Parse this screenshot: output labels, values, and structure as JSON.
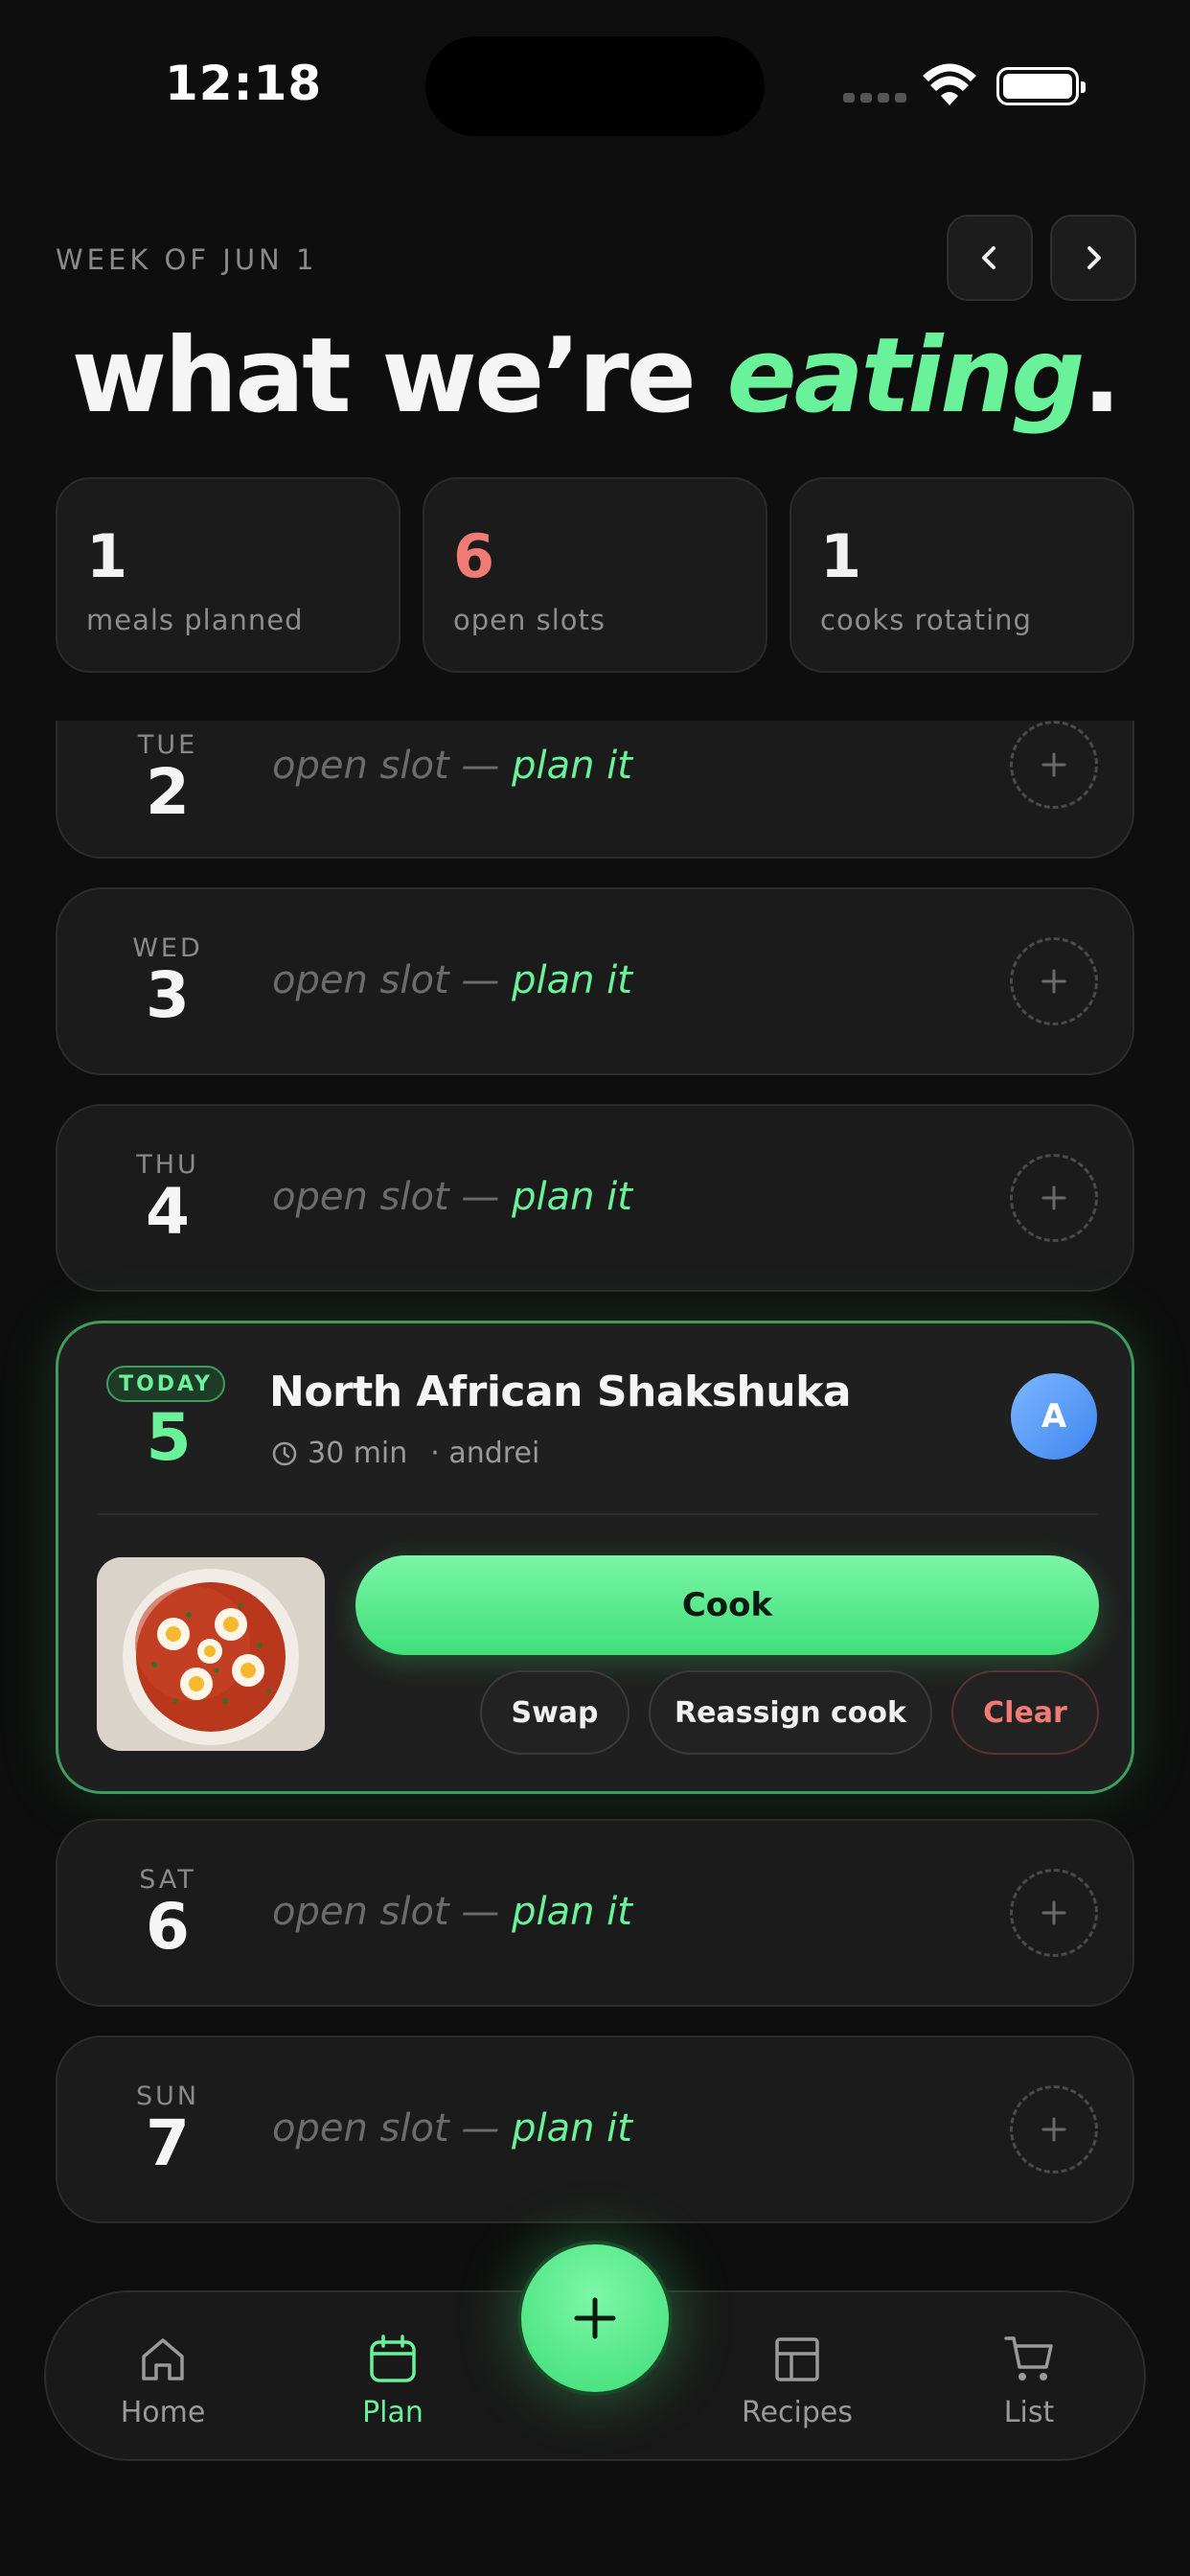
{
  "status": {
    "time": "12:18"
  },
  "header": {
    "week_label": "WEEK OF JUN 1",
    "title_main": "what we’re ",
    "title_accent": "eating",
    "title_end": "."
  },
  "stats": [
    {
      "value": "1",
      "label": "meals planned"
    },
    {
      "value": "6",
      "label": "open slots"
    },
    {
      "value": "1",
      "label": "cooks rotating"
    }
  ],
  "slot": {
    "open_text": "open slot — ",
    "plan_text": "plan it"
  },
  "days": [
    {
      "name": "TUE",
      "num": "2"
    },
    {
      "name": "WED",
      "num": "3"
    },
    {
      "name": "THU",
      "num": "4"
    },
    {
      "name": "SAT",
      "num": "6"
    },
    {
      "name": "SUN",
      "num": "7"
    }
  ],
  "today": {
    "badge": "TODAY",
    "num": "5",
    "meal": "North African Shakshuka",
    "duration": "30 min",
    "cook": "· andrei",
    "avatar": "A",
    "cook_button": "Cook",
    "swap": "Swap",
    "reassign": "Reassign cook",
    "clear": "Clear"
  },
  "nav": {
    "home": "Home",
    "plan": "Plan",
    "recipes": "Recipes",
    "list": "List"
  },
  "colors": {
    "accent": "#6af29a",
    "warning": "#ef7b74",
    "avatar": "#4a8ff2",
    "background": "#0e0e0e"
  },
  "icons": [
    "chevron-left-icon",
    "chevron-right-icon",
    "plus-icon",
    "clock-icon",
    "home-icon",
    "calendar-icon",
    "grid-icon",
    "cart-icon"
  ]
}
